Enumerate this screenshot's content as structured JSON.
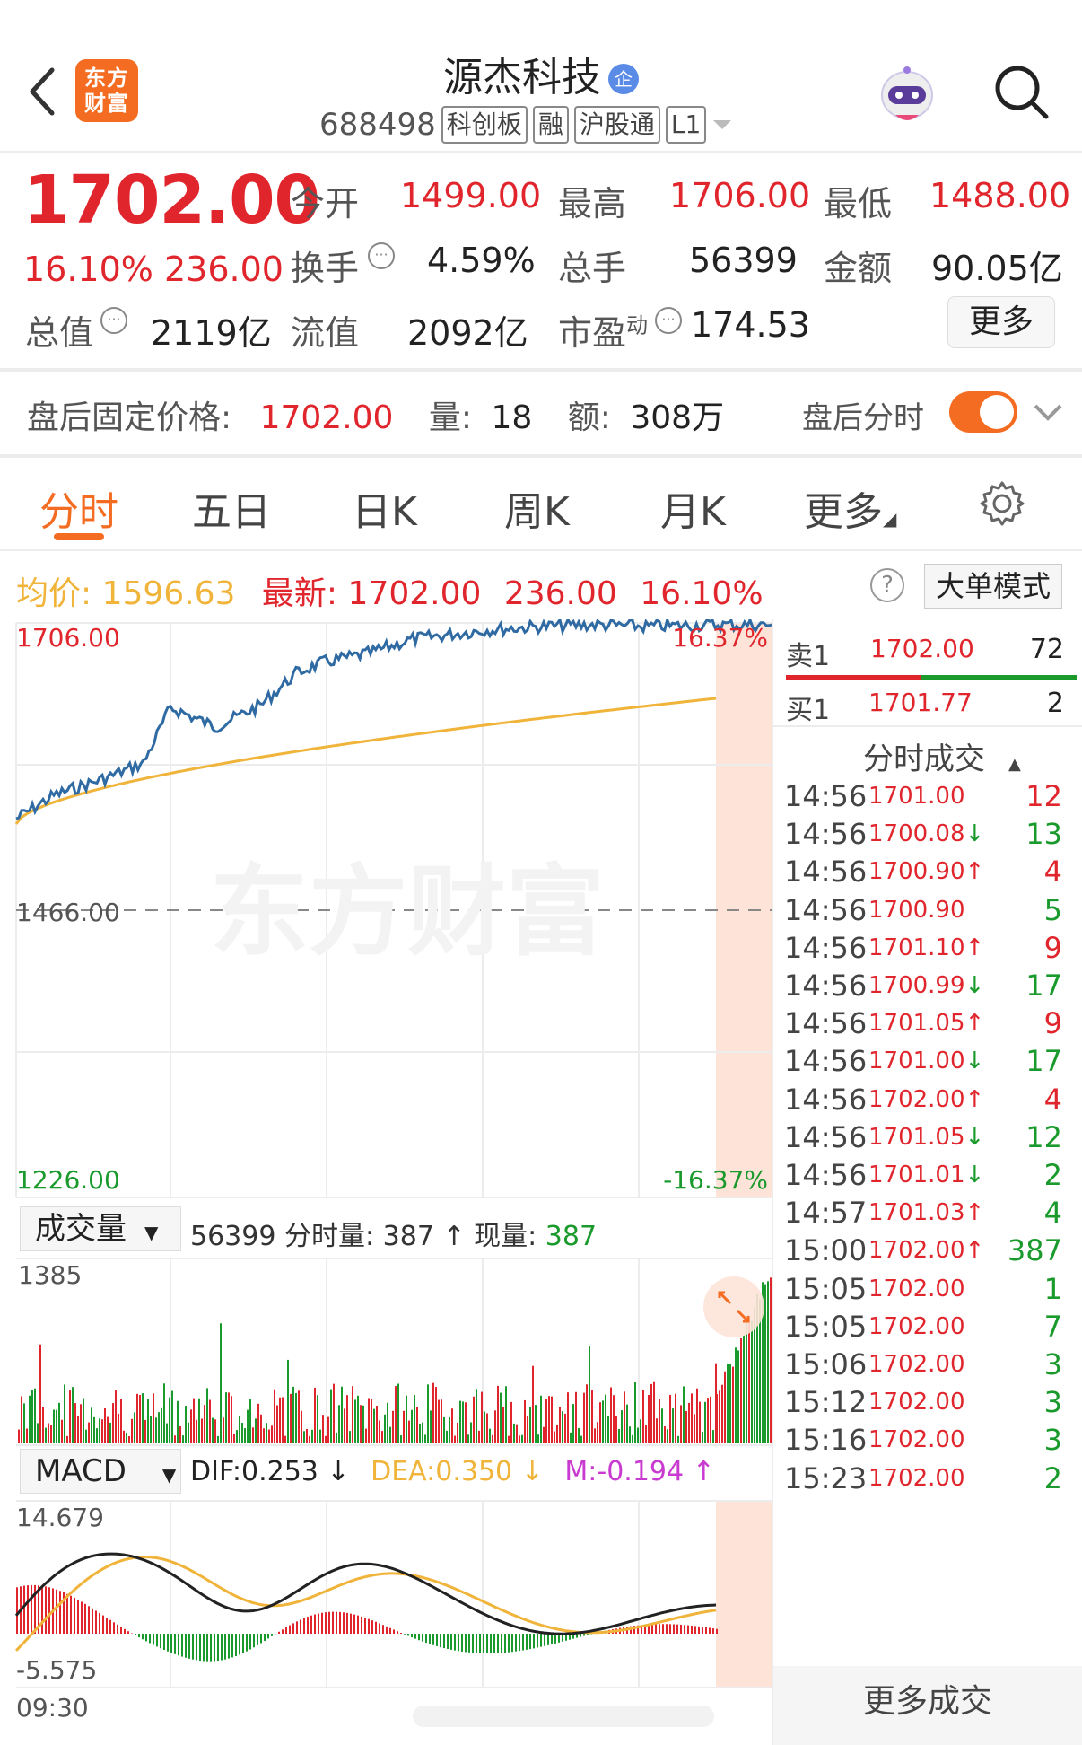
{
  "header": {
    "logo_text": "东方财富",
    "stock_name": "源杰科技",
    "badge": "企",
    "code": "688498",
    "tags": [
      "科创板",
      "融",
      "沪股通",
      "L1"
    ]
  },
  "quote": {
    "price": "1702.00",
    "change_pct": "16.10%",
    "change_amt": "236.00",
    "open_label": "今开",
    "open": "1499.00",
    "high_label": "最高",
    "high": "1706.00",
    "low_label": "最低",
    "low": "1488.00",
    "turnover_label": "换手",
    "turnover": "4.59%",
    "volume_label": "总手",
    "volume": "56399",
    "amount_label": "金额",
    "amount": "90.05亿",
    "mktcap_label": "总值",
    "mktcap": "2119亿",
    "float_label": "流值",
    "float": "2092亿",
    "pe_label": "市盈",
    "pe_sup": "动",
    "pe": "174.53",
    "more": "更多"
  },
  "after_hours": {
    "label": "盘后固定价格:",
    "price": "1702.00",
    "vol_label": "量:",
    "vol": "18",
    "amt_label": "额:",
    "amt": "308万",
    "switch_label": "盘后分时"
  },
  "tabs": [
    "分时",
    "五日",
    "日K",
    "周K",
    "月K",
    "更多"
  ],
  "avg_row": {
    "avg_label": "均价:",
    "avg": "1596.63",
    "last_label": "最新:",
    "last": "1702.00",
    "chg": "236.00",
    "pct": "16.10%",
    "help": "?",
    "big_order": "大单模式"
  },
  "price_chart": {
    "top_label": "1706.00",
    "mid_label": "1466.00",
    "bottom_label": "1226.00",
    "top_pct": "16.37%",
    "bottom_pct": "-16.37%",
    "watermark": "东方财富"
  },
  "volume_panel": {
    "selector": "成交量",
    "total": "56399",
    "bar_label": "分时量:",
    "bar_val": "387",
    "now_label": "现量:",
    "now_val": "387",
    "max_label": "1385"
  },
  "macd_panel": {
    "selector": "MACD",
    "dif": "DIF:0.253",
    "dea": "DEA:0.350",
    "m": "M:-0.194",
    "top_label": "14.679",
    "bottom_label": "-5.575",
    "time_start": "09:30"
  },
  "order_book": {
    "sell_label": "卖1",
    "sell_price": "1702.00",
    "sell_vol": "72",
    "buy_label": "买1",
    "buy_price": "1701.77",
    "buy_vol": "2",
    "trades_title": "分时成交",
    "trades": [
      {
        "t": "14:56",
        "p": "1701.00",
        "d": "",
        "v": "12",
        "c": "red"
      },
      {
        "t": "14:56",
        "p": "1700.08",
        "d": "↓",
        "v": "13",
        "c": "green"
      },
      {
        "t": "14:56",
        "p": "1700.90",
        "d": "↑",
        "v": "4",
        "c": "red"
      },
      {
        "t": "14:56",
        "p": "1700.90",
        "d": "",
        "v": "5",
        "c": "green"
      },
      {
        "t": "14:56",
        "p": "1701.10",
        "d": "↑",
        "v": "9",
        "c": "red"
      },
      {
        "t": "14:56",
        "p": "1700.99",
        "d": "↓",
        "v": "17",
        "c": "green"
      },
      {
        "t": "14:56",
        "p": "1701.05",
        "d": "↑",
        "v": "9",
        "c": "red"
      },
      {
        "t": "14:56",
        "p": "1701.00",
        "d": "↓",
        "v": "17",
        "c": "green"
      },
      {
        "t": "14:56",
        "p": "1702.00",
        "d": "↑",
        "v": "4",
        "c": "red"
      },
      {
        "t": "14:56",
        "p": "1701.05",
        "d": "↓",
        "v": "12",
        "c": "green"
      },
      {
        "t": "14:56",
        "p": "1701.01",
        "d": "↓",
        "v": "2",
        "c": "green"
      },
      {
        "t": "14:57",
        "p": "1701.03",
        "d": "↑",
        "v": "4",
        "c": "green"
      },
      {
        "t": "15:00",
        "p": "1702.00",
        "d": "↑",
        "v": "387",
        "c": "green"
      },
      {
        "t": "15:05",
        "p": "1702.00",
        "d": "",
        "v": "1",
        "c": "green"
      },
      {
        "t": "15:05",
        "p": "1702.00",
        "d": "",
        "v": "7",
        "c": "green"
      },
      {
        "t": "15:06",
        "p": "1702.00",
        "d": "",
        "v": "3",
        "c": "green"
      },
      {
        "t": "15:12",
        "p": "1702.00",
        "d": "",
        "v": "3",
        "c": "green"
      },
      {
        "t": "15:16",
        "p": "1702.00",
        "d": "",
        "v": "3",
        "c": "green"
      },
      {
        "t": "15:23",
        "p": "1702.00",
        "d": "",
        "v": "2",
        "c": "green"
      }
    ],
    "more_trades": "更多成交"
  },
  "colors": {
    "up": "#e0262c",
    "down": "#1a9a2c",
    "accent": "#f36c21",
    "price_line": "#2f6aa3",
    "avg_line": "#f0b43a"
  }
}
